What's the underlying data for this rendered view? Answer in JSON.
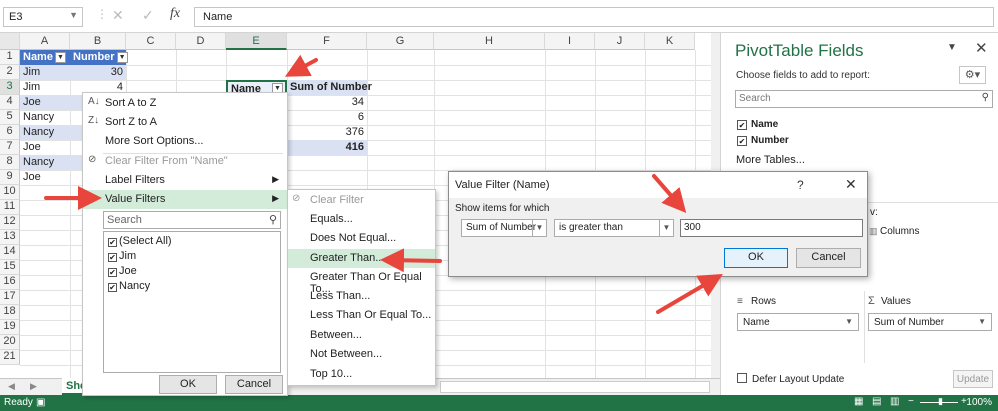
{
  "formula_bar": {
    "cell_ref": "E3",
    "formula": "Name",
    "fx": "fx"
  },
  "columns": [
    "A",
    "B",
    "C",
    "D",
    "E",
    "F",
    "G",
    "H",
    "I",
    "J",
    "K"
  ],
  "rows": [
    "1",
    "2",
    "3",
    "4",
    "5",
    "6",
    "7",
    "8",
    "9",
    "10",
    "11",
    "12",
    "13",
    "14",
    "15",
    "16",
    "17",
    "18",
    "19",
    "20",
    "21"
  ],
  "cells": {
    "a1": "Name",
    "b1": "Number",
    "a2": "Jim",
    "b2": "30",
    "a3": "Jim",
    "b3": "4",
    "a4": "Joe",
    "a5": "Nancy",
    "a6": "Nancy",
    "a7": "Joe",
    "a8": "Nancy",
    "a9": "Joe",
    "e3": "Name",
    "f3": "Sum of Number",
    "f4": "34",
    "f5": "6",
    "f6": "376",
    "f7": "416"
  },
  "sheet_tab": "Sheet1",
  "status": {
    "left": "Ready",
    "zoom": "100%"
  },
  "menu": {
    "sort_az": "Sort A to Z",
    "sort_za": "Sort Z to A",
    "more_sort": "More Sort Options...",
    "clear_filter": "Clear Filter From \"Name\"",
    "label_filters": "Label Filters",
    "value_filters": "Value Filters",
    "search_placeholder": "Search",
    "items": [
      "(Select All)",
      "Jim",
      "Joe",
      "Nancy"
    ],
    "ok": "OK",
    "cancel": "Cancel"
  },
  "submenu": {
    "items": [
      "Clear Filter",
      "Equals...",
      "Does Not Equal...",
      "Greater Than...",
      "Greater Than Or Equal To...",
      "Less Than...",
      "Less Than Or Equal To...",
      "Between...",
      "Not Between...",
      "Top 10..."
    ]
  },
  "dialog": {
    "title": "Value Filter (Name)",
    "help": "?",
    "close": "✕",
    "label": "Show items for which",
    "field": "Sum of Number",
    "operator": "is greater than",
    "value": "300",
    "ok": "OK",
    "cancel": "Cancel"
  },
  "pane": {
    "title": "PivotTable Fields",
    "subtitle": "Choose fields to add to report:",
    "search_placeholder": "Search",
    "fields": [
      "Name",
      "Number"
    ],
    "more_tables": "More Tables...",
    "partial_v": "v:",
    "columns": "Columns",
    "rows": "Rows",
    "values": "Values",
    "rows_value": "Name",
    "values_value": "Sum of Number",
    "defer": "Defer Layout Update",
    "update": "Update"
  },
  "colors": {
    "accent": "#217346",
    "header_blue": "#4472c4",
    "light_blue": "#d9e1f2",
    "highlight": "#d3ebd9",
    "arrow": "#e8453c"
  }
}
